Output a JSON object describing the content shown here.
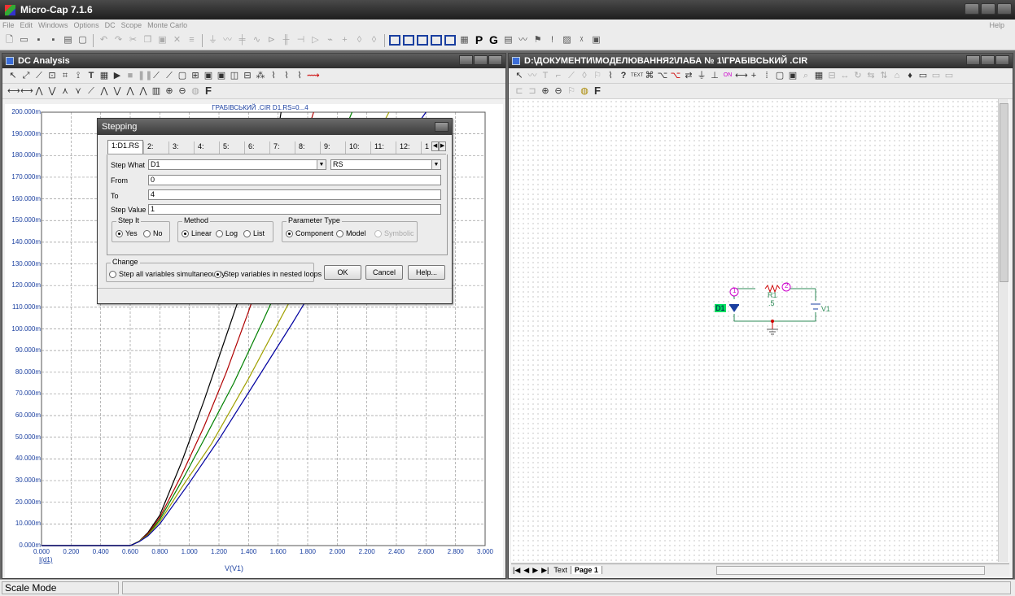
{
  "app": {
    "title": "Micro-Cap 7.1.6"
  },
  "menu": {
    "items": [
      "File",
      "Edit",
      "Windows",
      "Options",
      "DC",
      "Scope",
      "Monte Carlo"
    ],
    "help": "Help"
  },
  "toolbar": {
    "p_label": "P",
    "g_label": "G"
  },
  "dc_window": {
    "title": "DC Analysis",
    "zoom_label": "F",
    "plot": {
      "header": "ГРАБІВСЬКИЙ .CIR D1.RS=0...4",
      "y_label": "I(d1)",
      "x_label": "V(V1)",
      "y_ticks": [
        "200.000m",
        "190.000m",
        "180.000m",
        "170.000m",
        "160.000m",
        "150.000m",
        "140.000m",
        "130.000m",
        "120.000m",
        "110.000m",
        "100.000m",
        "90.000m",
        "80.000m",
        "70.000m",
        "60.000m",
        "50.000m",
        "40.000m",
        "30.000m",
        "20.000m",
        "10.000m",
        "0.000m"
      ],
      "x_ticks": [
        "0.000",
        "0.200",
        "0.400",
        "0.600",
        "0.800",
        "1.000",
        "1.200",
        "1.400",
        "1.600",
        "1.800",
        "2.000",
        "2.200",
        "2.400",
        "2.600",
        "2.800",
        "3.000"
      ]
    }
  },
  "chart_data": {
    "type": "line",
    "title": "ГРАБІВСЬКИЙ .CIR D1.RS=0...4",
    "xlabel": "V(V1)",
    "ylabel": "I(d1)",
    "xlim": [
      0,
      3.0
    ],
    "ylim": [
      0,
      200
    ],
    "y_unit": "m",
    "grid": true,
    "series": [
      {
        "color": "#000000",
        "x": [
          0,
          0.6,
          0.66,
          0.72,
          0.8,
          0.95,
          1.1,
          1.25,
          1.35,
          1.45,
          1.55,
          1.62
        ],
        "y": [
          0,
          0,
          2,
          6,
          14,
          39,
          67,
          97,
          117,
          140,
          170,
          200
        ]
      },
      {
        "color": "#b00000",
        "x": [
          0,
          0.6,
          0.66,
          0.72,
          0.8,
          0.95,
          1.1,
          1.25,
          1.4,
          1.55,
          1.7,
          1.84
        ],
        "y": [
          0,
          0,
          2,
          5.5,
          13,
          33,
          55,
          80,
          108,
          138,
          170,
          200
        ]
      },
      {
        "color": "#008000",
        "x": [
          0,
          0.6,
          0.66,
          0.72,
          0.8,
          0.95,
          1.1,
          1.3,
          1.5,
          1.7,
          1.9,
          2.1
        ],
        "y": [
          0,
          0,
          2,
          5,
          12,
          30,
          49,
          75,
          104,
          134,
          167,
          200
        ]
      },
      {
        "color": "#a0a000",
        "x": [
          0,
          0.6,
          0.66,
          0.72,
          0.8,
          0.95,
          1.15,
          1.4,
          1.65,
          1.9,
          2.15,
          2.35
        ],
        "y": [
          0,
          0,
          2,
          4.8,
          11,
          27,
          47,
          77,
          109,
          141,
          174,
          200
        ]
      },
      {
        "color": "#0000a0",
        "x": [
          0,
          0.6,
          0.66,
          0.72,
          0.8,
          1.0,
          1.2,
          1.45,
          1.7,
          2.0,
          2.3,
          2.6
        ],
        "y": [
          0,
          0,
          1.8,
          4.5,
          10,
          29,
          49,
          76,
          103,
          137,
          171,
          200
        ]
      }
    ]
  },
  "stepping": {
    "title": "Stepping",
    "tabs": [
      "1:D1.RS",
      "2:",
      "3:",
      "4:",
      "5:",
      "6:",
      "7:",
      "8:",
      "9:",
      "10:",
      "11:",
      "12:",
      "1"
    ],
    "step_what_label": "Step What",
    "step_what_value": "D1",
    "step_what_param": "RS",
    "from_label": "From",
    "from_value": "0",
    "to_label": "To",
    "to_value": "4",
    "step_value_label": "Step Value",
    "step_value_value": "1",
    "step_it": {
      "title": "Step It",
      "yes": "Yes",
      "no": "No"
    },
    "method": {
      "title": "Method",
      "linear": "Linear",
      "log": "Log",
      "list": "List"
    },
    "param_type": {
      "title": "Parameter Type",
      "component": "Component",
      "model": "Model",
      "symbolic": "Symbolic"
    },
    "change": {
      "title": "Change",
      "simultaneous": "Step all variables simultaneously",
      "nested": "Step variables in nested loops"
    },
    "ok": "OK",
    "cancel": "Cancel",
    "help": "Help..."
  },
  "schematic": {
    "title": "D:\\ДОКУМЕНТИ\\МОДЕЛЮВАННЯ2\\ЛАБА № 1\\ГРАБІВСЬКИЙ .CIR",
    "zoom_label": "F",
    "node1": "1",
    "node2": "2",
    "r_label": "R1",
    "r_value": ".5",
    "d_label": "D1",
    "v_label": "V1",
    "tab_text": "Text",
    "tab_page": "Page 1"
  },
  "status": {
    "mode": "Scale Mode"
  }
}
